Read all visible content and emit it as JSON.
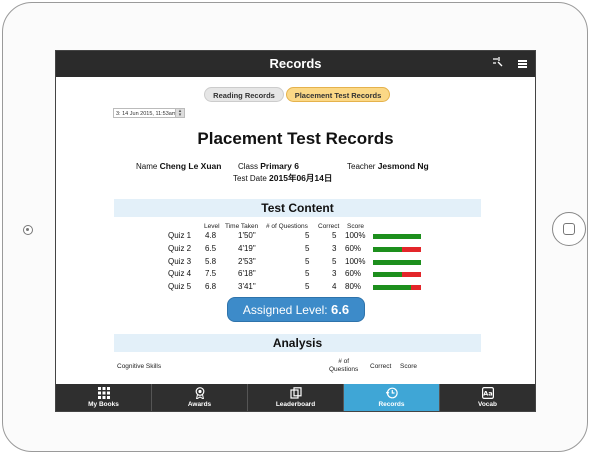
{
  "header": {
    "title": "Records"
  },
  "tabs": {
    "reading": "Reading Records",
    "placement": "Placement Test Records"
  },
  "date_select": {
    "value": "3: 14 Jun 2015, 11:53am"
  },
  "page_title": "Placement Test Records",
  "student": {
    "name_label": "Name",
    "name": "Cheng Le Xuan",
    "class_label": "Class",
    "class": "Primary 6",
    "teacher_label": "Teacher",
    "teacher": "Jesmond Ng",
    "date_label": "Test Date",
    "date": "2015年06月14日"
  },
  "test_content": {
    "title": "Test Content",
    "headers": {
      "level": "Level",
      "time": "Time Taken",
      "questions": "# of Questions",
      "correct": "Correct",
      "score": "Score"
    },
    "rows": [
      {
        "name": "Quiz 1",
        "level": "4.8",
        "time": "1'50\"",
        "questions": "5",
        "correct": "5",
        "score": "100%",
        "fraction": 1.0
      },
      {
        "name": "Quiz 2",
        "level": "6.5",
        "time": "4'19\"",
        "questions": "5",
        "correct": "3",
        "score": "60%",
        "fraction": 0.6
      },
      {
        "name": "Quiz 3",
        "level": "5.8",
        "time": "2'53\"",
        "questions": "5",
        "correct": "5",
        "score": "100%",
        "fraction": 1.0
      },
      {
        "name": "Quiz 4",
        "level": "7.5",
        "time": "6'18\"",
        "questions": "5",
        "correct": "3",
        "score": "60%",
        "fraction": 0.6
      },
      {
        "name": "Quiz 5",
        "level": "6.8",
        "time": "3'41\"",
        "questions": "5",
        "correct": "4",
        "score": "80%",
        "fraction": 0.8
      }
    ]
  },
  "assigned": {
    "label": "Assigned Level:",
    "value": "6.6"
  },
  "analysis": {
    "title": "Analysis",
    "headers": {
      "skills": "Cognitive Skills",
      "questions_1": "# of",
      "questions_2": "Questions",
      "correct": "Correct",
      "score": "Score"
    }
  },
  "bottom_nav": {
    "my_books": "My Books",
    "awards": "Awards",
    "leaderboard": "Leaderboard",
    "records": "Records",
    "vocab": "Vocab"
  },
  "colors": {
    "accent": "#3fa6d6",
    "tab_active": "#fbd886",
    "section_bg": "#e3f0f9",
    "bar_green": "#1d8f1d",
    "bar_red": "#e3262a",
    "assigned_bg": "#3d8bc9"
  }
}
